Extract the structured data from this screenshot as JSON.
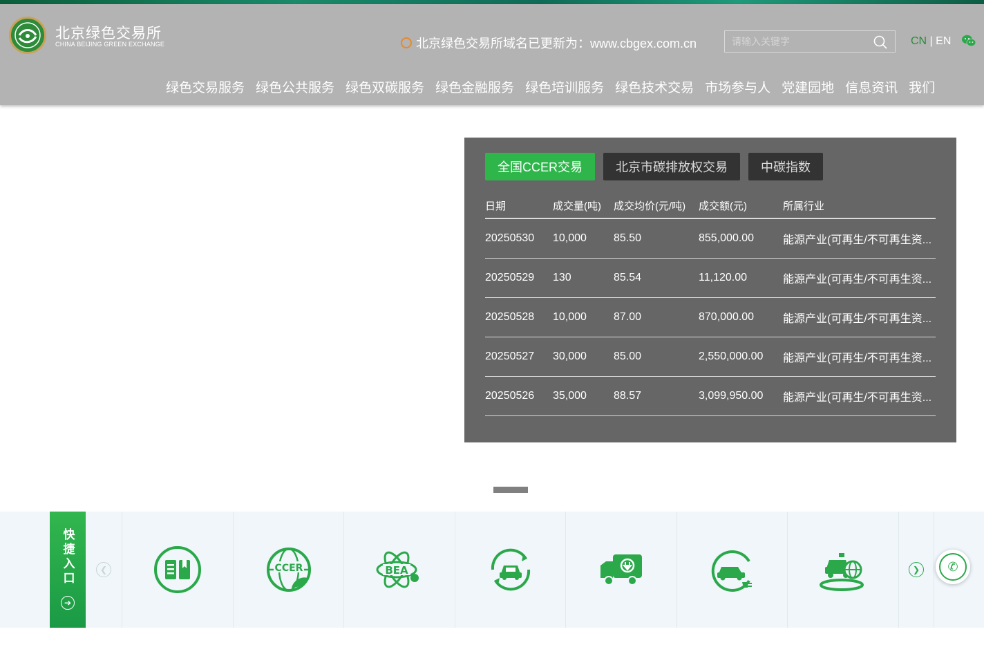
{
  "header": {
    "brand_cn": "北京绿色交易所",
    "brand_en": "CHINA BEIJING GREEN EXCHANGE",
    "notice": "北京绿色交易所域名已更新为：www.cbgex.com.cn",
    "search_placeholder": "请输入关键字",
    "lang_cn": "CN",
    "lang_sep": " | ",
    "lang_en": "EN",
    "accent_color": "#2fb64b"
  },
  "nav": {
    "items": [
      {
        "label": "绿色交易服务"
      },
      {
        "label": "绿色公共服务"
      },
      {
        "label": "绿色双碳服务"
      },
      {
        "label": "绿色金融服务"
      },
      {
        "label": "绿色培训服务"
      },
      {
        "label": "绿色技术交易"
      },
      {
        "label": "市场参与人"
      },
      {
        "label": "党建园地"
      },
      {
        "label": "信息资讯"
      },
      {
        "label": "我们"
      }
    ]
  },
  "trade": {
    "tabs": [
      {
        "label": "全国CCER交易",
        "active": true
      },
      {
        "label": "北京市碳排放权交易",
        "active": false
      },
      {
        "label": "中碳指数",
        "active": false
      }
    ],
    "columns": [
      "日期",
      "成交量(吨)",
      "成交均价(元/吨)",
      "成交额(元)",
      "所属行业"
    ],
    "rows": [
      [
        "20250530",
        "10,000",
        "85.50",
        "855,000.00",
        "能源产业(可再生/不可再生资..."
      ],
      [
        "20250529",
        "130",
        "85.54",
        "11,120.00",
        "能源产业(可再生/不可再生资..."
      ],
      [
        "20250528",
        "10,000",
        "87.00",
        "870,000.00",
        "能源产业(可再生/不可再生资..."
      ],
      [
        "20250527",
        "30,000",
        "85.00",
        "2,550,000.00",
        "能源产业(可再生/不可再生资..."
      ],
      [
        "20250526",
        "35,000",
        "88.57",
        "3,099,950.00",
        "能源产业(可再生/不可再生资..."
      ]
    ]
  },
  "quick": {
    "label": "快捷入口",
    "icons": [
      "book-icon",
      "ccer-globe-icon",
      "bea-atom-icon",
      "car-cycle-icon",
      "ev-truck-icon",
      "ev-car-icon",
      "car-globe-icon"
    ]
  }
}
